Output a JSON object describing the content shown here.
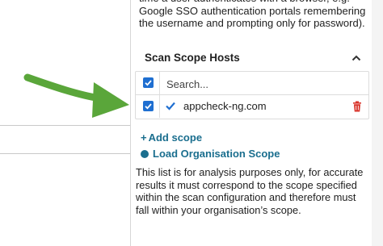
{
  "help_text": "time a user authenticates with a browser, e.g. Google SSO authentication portals remembering the username and prompting only for password).",
  "scan_scope": {
    "title": "Scan Scope Hosts",
    "search_placeholder": "Search...",
    "hosts": [
      {
        "label": "appcheck-ng.com",
        "checked": true,
        "verified": true
      }
    ]
  },
  "actions": {
    "add_scope": "Add scope",
    "load_org_scope": "Load Organisation Scope"
  },
  "info_text": "This list is for analysis purposes only, for accurate results it must correspond to the scope specified within the scan configuration and therefore must fall within your organisation’s scope.",
  "colors": {
    "accent": "#1a6e8e",
    "checkbox": "#1f6fd1",
    "delete": "#d9342b",
    "arrow": "#5aa63a"
  },
  "icons": {
    "collapse": "chevron-up-icon",
    "verified": "checkmark-icon",
    "delete": "trash-icon",
    "load": "circle-icon",
    "add": "plus-icon"
  }
}
